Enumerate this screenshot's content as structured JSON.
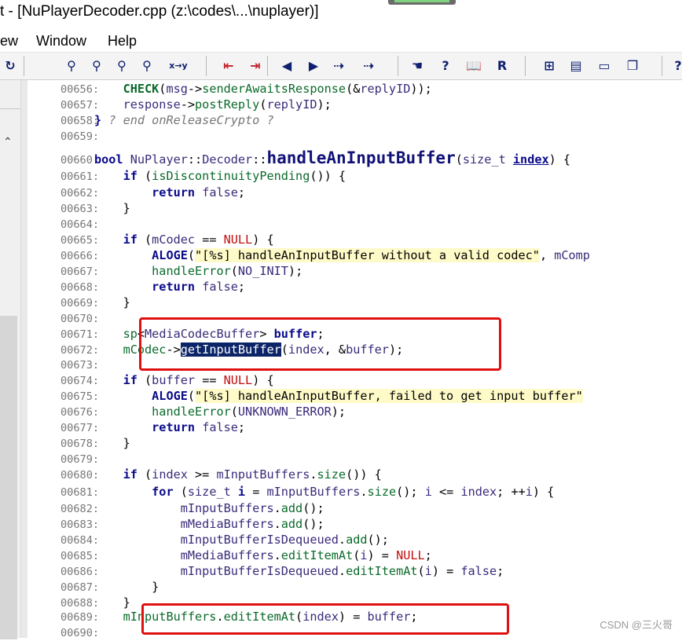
{
  "window": {
    "title": "t - [NuPlayerDecoder.cpp (z:\\codes\\...\\nuplayer)]"
  },
  "menu": {
    "items": [
      "ew",
      "Window",
      "Help"
    ]
  },
  "toolbar": {
    "buttons": [
      {
        "name": "redo-icon",
        "glyph": "↻"
      },
      {
        "name": "find-icon",
        "glyph": "⚲"
      },
      {
        "name": "find-prev-icon",
        "glyph": "⚲"
      },
      {
        "name": "find-next-icon",
        "glyph": "⚲"
      },
      {
        "name": "find-in-files-icon",
        "glyph": "⚲"
      },
      {
        "name": "replace-icon",
        "glyph": "x→y"
      },
      {
        "name": "bookmark-prev-icon",
        "glyph": "⇤"
      },
      {
        "name": "bookmark-next-icon",
        "glyph": "⇥"
      },
      {
        "name": "back-icon",
        "glyph": "◀"
      },
      {
        "name": "forward-icon",
        "glyph": "▶"
      },
      {
        "name": "jump-icon",
        "glyph": "⇢"
      },
      {
        "name": "jump-def-icon",
        "glyph": "⇢"
      },
      {
        "name": "symbol-icon",
        "glyph": "☚"
      },
      {
        "name": "info-icon",
        "glyph": "?"
      },
      {
        "name": "book-icon",
        "glyph": "📖"
      },
      {
        "name": "relation-icon",
        "glyph": "R"
      },
      {
        "name": "layout-1-icon",
        "glyph": "⊞"
      },
      {
        "name": "layout-2-icon",
        "glyph": "▤"
      },
      {
        "name": "layout-3-icon",
        "glyph": "▭"
      },
      {
        "name": "layout-4-icon",
        "glyph": "❐"
      },
      {
        "name": "help-icon",
        "glyph": "?"
      }
    ]
  },
  "code": {
    "lines": [
      {
        "n": "00656:",
        "html": "    <span class='kw fn'>CHECK</span>(<span class='id'>msg</span>-><span class='fn'>senderAwaitsResponse</span>(&amp;<span class='id'>replyID</span>));"
      },
      {
        "n": "00657:",
        "html": "    <span class='id'>response</span>-><span class='fn'>postReply</span>(<span class='id'>replyID</span>);"
      },
      {
        "n": "00658:",
        "html": "<span class='kw'>}</span> <span class='ct'>? end onReleaseCrypto ?</span>"
      },
      {
        "n": "00659:",
        "html": ""
      },
      {
        "n": "00660:",
        "html": "<span class='kw'>bool</span> <span class='id'>NuPlayer</span>::<span class='id'>Decoder</span>::<span class='big'>handleAnInputBuffer</span>(<span class='id'>size_t</span> <span class='ul'>index</span>) {"
      },
      {
        "n": "00661:",
        "html": "    <span class='kw'>if</span> (<span class='fn'>isDiscontinuityPending</span>()) {"
      },
      {
        "n": "00662:",
        "html": "        <span class='kw'>return</span> <span class='id'>false</span>;"
      },
      {
        "n": "00663:",
        "html": "    }"
      },
      {
        "n": "00664:",
        "html": ""
      },
      {
        "n": "00665:",
        "html": "    <span class='kw'>if</span> (<span class='id'>mCodec</span> == <span class='co'>NULL</span>) {"
      },
      {
        "n": "00666:",
        "html": "        <span class='kw'>ALOGE</span>(<span class='hl'>\"[%s] handleAnInputBuffer without a valid codec\"</span>, <span class='id'>mComp</span>"
      },
      {
        "n": "00667:",
        "html": "        <span class='fn'>handleError</span>(<span class='id'>NO_INIT</span>);"
      },
      {
        "n": "00668:",
        "html": "        <span class='kw'>return</span> <span class='id'>false</span>;"
      },
      {
        "n": "00669:",
        "html": "    }"
      },
      {
        "n": "00670:",
        "html": ""
      },
      {
        "n": "00671:",
        "html": "    <span class='fn'>sp</span>&lt;<span class='id'>MediaCodecBuffer</span>&gt; <span class='kw'>buffer</span>;"
      },
      {
        "n": "00672:",
        "html": "    <span class='fn'>mCodec</span>-><span class='sel'>getInputBuffer</span>(<span class='id'>index</span>, &amp;<span class='id'>buffer</span>);"
      },
      {
        "n": "00673:",
        "html": ""
      },
      {
        "n": "00674:",
        "html": "    <span class='kw'>if</span> (<span class='id'>buffer</span> == <span class='co'>NULL</span>) {"
      },
      {
        "n": "00675:",
        "html": "        <span class='kw'>ALOGE</span>(<span class='hl'>\"[%s] handleAnInputBuffer, failed to get input buffer\"</span>"
      },
      {
        "n": "00676:",
        "html": "        <span class='fn'>handleError</span>(<span class='id'>UNKNOWN_ERROR</span>);"
      },
      {
        "n": "00677:",
        "html": "        <span class='kw'>return</span> <span class='id'>false</span>;"
      },
      {
        "n": "00678:",
        "html": "    }"
      },
      {
        "n": "00679:",
        "html": ""
      },
      {
        "n": "00680:",
        "html": "    <span class='kw'>if</span> (<span class='id'>index</span> &gt;= <span class='id'>mInputBuffers</span>.<span class='fn'>size</span>()) {"
      },
      {
        "n": "00681:",
        "html": "        <span class='kw'>for</span> (<span class='id'>size_t</span> <span class='kw'>i</span> = <span class='id'>mInputBuffers</span>.<span class='fn'>size</span>(); <span class='id'>i</span> &lt;= <span class='id'>index</span>; ++<span class='id'>i</span>) {"
      },
      {
        "n": "00682:",
        "html": "            <span class='id'>mInputBuffers</span>.<span class='fn'>add</span>();"
      },
      {
        "n": "00683:",
        "html": "            <span class='id'>mMediaBuffers</span>.<span class='fn'>add</span>();"
      },
      {
        "n": "00684:",
        "html": "            <span class='id'>mInputBufferIsDequeued</span>.<span class='fn'>add</span>();"
      },
      {
        "n": "00685:",
        "html": "            <span class='id'>mMediaBuffers</span>.<span class='fn'>editItemAt</span>(<span class='id'>i</span>) = <span class='co'>NULL</span>;"
      },
      {
        "n": "00686:",
        "html": "            <span class='id'>mInputBufferIsDequeued</span>.<span class='fn'>editItemAt</span>(<span class='id'>i</span>) = <span class='id'>false</span>;"
      },
      {
        "n": "00687:",
        "html": "        }"
      },
      {
        "n": "00688:",
        "html": "    }"
      },
      {
        "n": "00689:",
        "html": "    <span class='fn'>mInputBuffers</span>.<span class='fn'>editItemAt</span>(<span class='id'>index</span>) = <span class='id'>buffer</span>;"
      },
      {
        "n": "00690:",
        "html": ""
      }
    ]
  },
  "watermark": "CSDN @三火哥"
}
